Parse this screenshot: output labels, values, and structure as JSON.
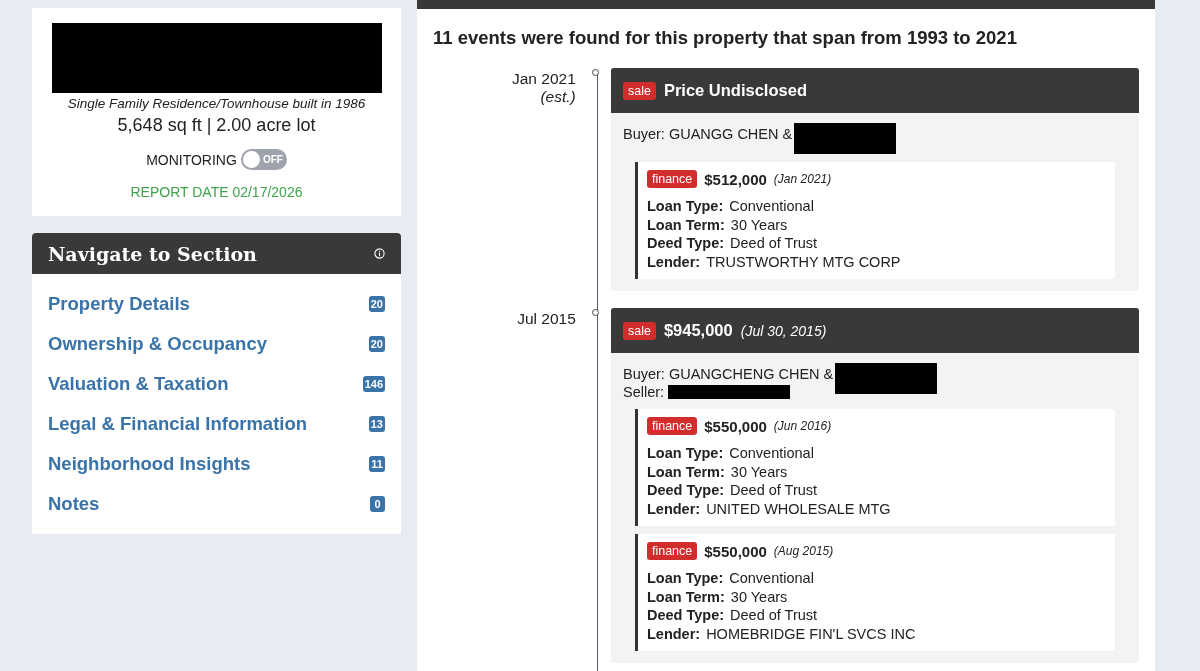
{
  "property": {
    "redacted_address": true,
    "description": "Single Family Residence/Townhouse built in 1986",
    "size": "5,648 sq ft | 2.00 acre lot",
    "monitoring": {
      "label": "MONITORING",
      "on": false,
      "state_text": "OFF"
    },
    "report_date": "REPORT DATE 02/17/2026"
  },
  "navigation": {
    "title": "Navigate to Section",
    "items": [
      {
        "label": "Property Details",
        "count": "20"
      },
      {
        "label": "Ownership & Occupancy",
        "count": "20"
      },
      {
        "label": "Valuation & Taxation",
        "count": "146"
      },
      {
        "label": "Legal & Financial Information",
        "count": "13"
      },
      {
        "label": "Neighborhood Insights",
        "count": "11"
      },
      {
        "label": "Notes",
        "count": "0"
      }
    ]
  },
  "history": {
    "summary": "11 events were found for this property that span from 1993 to 2021",
    "events": [
      {
        "date": "Jan 2021",
        "date_note": "(est.)",
        "tag": "sale",
        "price": "Price Undisclosed",
        "parties": [
          {
            "text": "Buyer: GUANGG CHEN &",
            "redacted": true
          }
        ],
        "finances": [
          {
            "tag": "finance",
            "amount": "$512,000",
            "date": "(Jan 2021)",
            "details": [
              {
                "label": "Loan Type:",
                "value": "Conventional"
              },
              {
                "label": "Loan Term:",
                "value": "30 Years"
              },
              {
                "label": "Deed Type:",
                "value": "Deed of Trust"
              },
              {
                "label": "Lender:",
                "value": "TRUSTWORTHY MTG CORP"
              }
            ]
          }
        ]
      },
      {
        "date": "Jul 2015",
        "tag": "sale",
        "price": "$945,000",
        "price_date": "(Jul 30, 2015)",
        "parties": [
          {
            "text": "Buyer: GUANGCHENG CHEN &",
            "redacted": true
          },
          {
            "text": "Seller:",
            "redacted": true
          }
        ],
        "finances": [
          {
            "tag": "finance",
            "amount": "$550,000",
            "date": "(Jun 2016)",
            "details": [
              {
                "label": "Loan Type:",
                "value": "Conventional"
              },
              {
                "label": "Loan Term:",
                "value": "30 Years"
              },
              {
                "label": "Deed Type:",
                "value": "Deed of Trust"
              },
              {
                "label": "Lender:",
                "value": "UNITED WHOLESALE MTG"
              }
            ]
          },
          {
            "tag": "finance",
            "amount": "$550,000",
            "date": "(Aug 2015)",
            "details": [
              {
                "label": "Loan Type:",
                "value": "Conventional"
              },
              {
                "label": "Loan Term:",
                "value": "30 Years"
              },
              {
                "label": "Deed Type:",
                "value": "Deed of Trust"
              },
              {
                "label": "Lender:",
                "value": "HOMEBRIDGE FIN'L SVCS INC"
              }
            ]
          }
        ]
      }
    ]
  }
}
